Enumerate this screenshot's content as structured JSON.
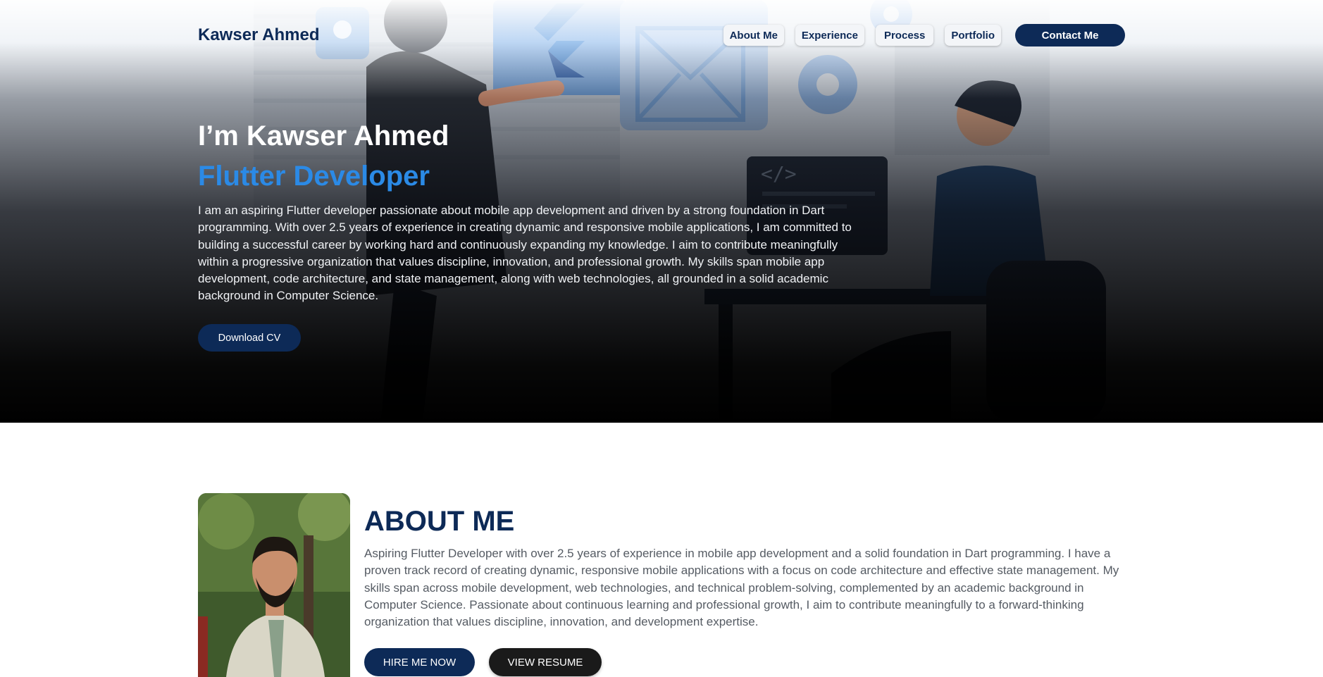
{
  "header": {
    "brand": "Kawser Ahmed",
    "nav": [
      "About Me",
      "Experience",
      "Process",
      "Portfolio"
    ],
    "contact_label": "Contact Me"
  },
  "hero": {
    "greeting": "I’m Kawser Ahmed",
    "role": "Flutter Developer",
    "description": "I am an aspiring Flutter developer passionate about mobile app development and driven by a strong foundation in Dart programming. With over 2.5 years of experience in creating dynamic and responsive mobile applications, I am committed to building a successful career by working hard and continuously expanding my knowledge. I aim to contribute meaningfully within a progressive organization that values discipline, innovation, and professional growth. My skills span mobile app development, code architecture, and state management, along with web technologies, all grounded in a solid academic background in Computer Science.",
    "cv_label": "Download CV",
    "code_glyph": "</>"
  },
  "about": {
    "title": "ABOUT ME",
    "description": "Aspiring Flutter Developer with over 2.5 years of experience in mobile app development and a solid foundation in Dart programming. I have a proven track record of creating dynamic, responsive mobile applications with a focus on code architecture and effective state management. My skills span across mobile development, web technologies, and technical problem-solving, complemented by an academic background in Computer Science. Passionate about continuous learning and professional growth, I aim to contribute meaningfully to a forward-thinking organization that values discipline, innovation, and development expertise.",
    "hire_label": "HIRE ME NOW",
    "resume_label": "VIEW RESUME"
  },
  "colors": {
    "navy": "#0d2a57",
    "accent_blue": "#2b8ae6",
    "dark_button": "#1a1a1a"
  }
}
